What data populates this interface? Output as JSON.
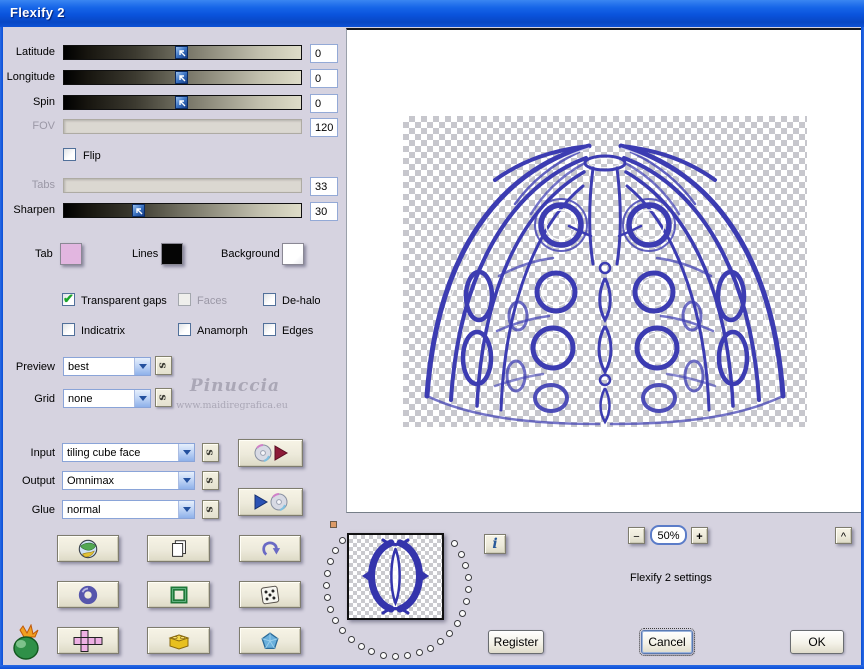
{
  "window": {
    "title": "Flexify 2"
  },
  "sliders": [
    {
      "label": "Latitude",
      "value": "0",
      "disabled": false,
      "frac": 0.49
    },
    {
      "label": "Longitude",
      "value": "0",
      "disabled": false,
      "frac": 0.49
    },
    {
      "label": "Spin",
      "value": "0",
      "disabled": false,
      "frac": 0.49
    },
    {
      "label": "FOV",
      "value": "120",
      "disabled": true
    },
    {
      "label": "Tabs",
      "value": "33",
      "disabled": true
    },
    {
      "label": "Sharpen",
      "value": "30",
      "disabled": false,
      "frac": 0.3
    }
  ],
  "flip": {
    "label": "Flip",
    "checked": false
  },
  "swatches": [
    {
      "label": "Tab",
      "color": "#e2b6e0"
    },
    {
      "label": "Lines",
      "color": "#050505"
    },
    {
      "label": "Background",
      "color": "#ffffff"
    }
  ],
  "checkboxes": [
    {
      "label": "Transparent gaps",
      "checked": true,
      "disabled": false
    },
    {
      "label": "Faces",
      "checked": false,
      "disabled": true
    },
    {
      "label": "De-halo",
      "checked": false,
      "disabled": false
    },
    {
      "label": "Indicatrix",
      "checked": false,
      "disabled": false
    },
    {
      "label": "Anamorph",
      "checked": false,
      "disabled": false
    },
    {
      "label": "Edges",
      "checked": false,
      "disabled": false
    }
  ],
  "combos": [
    {
      "label": "Preview",
      "value": "best"
    },
    {
      "label": "Grid",
      "value": "none"
    },
    {
      "label": "Input",
      "value": "tiling cube face"
    },
    {
      "label": "Output",
      "value": "Omnimax"
    },
    {
      "label": "Glue",
      "value": "normal"
    }
  ],
  "glyphs": {
    "seed": "s",
    "check": "✔",
    "info": "i",
    "zoom_minus": "−",
    "zoom_plus": "+",
    "collapse": "^"
  },
  "zoom": {
    "value": "50%"
  },
  "status_text": "Flexify 2 settings",
  "buttons": {
    "register": "Register",
    "cancel": "Cancel",
    "ok": "OK"
  },
  "watermark": {
    "line1": "Pinuccia",
    "line2": "www.maidiregrafica.eu"
  },
  "colors": {
    "titlebar_blue": "#0b4fd7",
    "dialog_bg": "#d6d3e0",
    "artwork_blue": "#3c3cb2",
    "slider_track_dark": "#000000",
    "slider_track_light": "#dedcc8"
  }
}
